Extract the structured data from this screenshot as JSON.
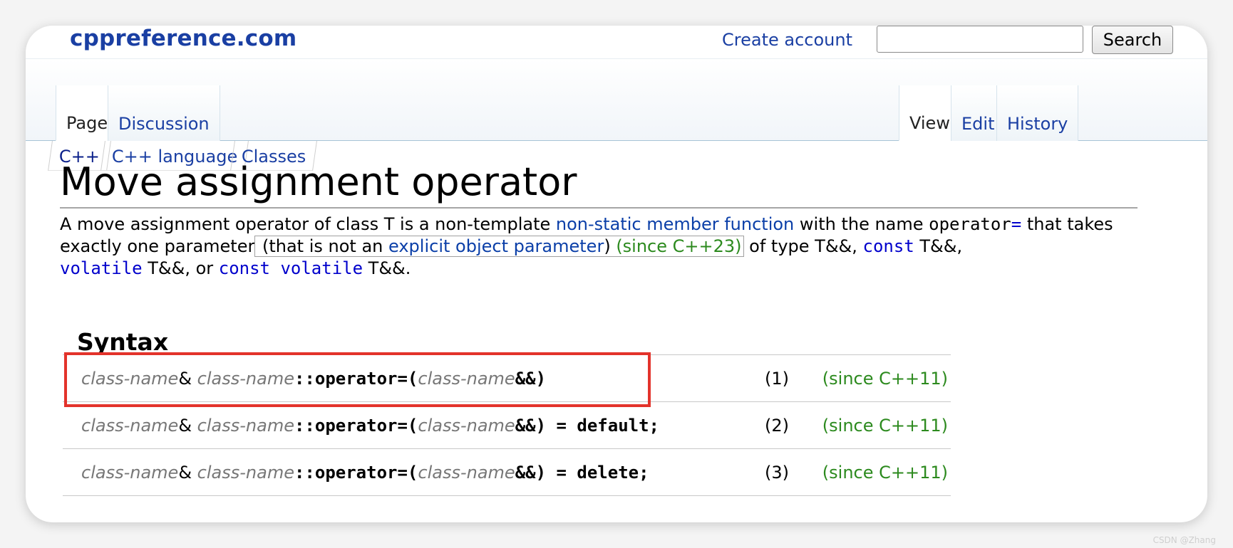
{
  "header": {
    "logo": "cppreference.com",
    "create_account": "Create account",
    "search_placeholder": "",
    "search_button": "Search"
  },
  "tabs_left": [
    {
      "label": "Page",
      "selected": true
    },
    {
      "label": "Discussion",
      "selected": false
    }
  ],
  "tabs_right": [
    {
      "label": "View",
      "selected": true
    },
    {
      "label": "Edit",
      "selected": false
    },
    {
      "label": "History",
      "selected": false
    }
  ],
  "breadcrumbs": [
    "C++",
    "C++ language",
    "Classes"
  ],
  "page": {
    "title": "Move assignment operator",
    "desc": {
      "t1": "A move assignment operator of class T is a non-template ",
      "link1": "non-static member function",
      "t2": " with the name ",
      "op_mono": "operator",
      "op_eq": "=",
      "t3": " that takes exactly one parameter",
      "box_t1": " (that is not an ",
      "box_link": "explicit object parameter",
      "box_t2": ") ",
      "box_since": "(since C++23)",
      "t4": " of type T&&, ",
      "kw_const": "const",
      "t5": " T&&, ",
      "kw_volatile": "volatile",
      "t6": " T&&, or ",
      "kw_const_volatile": "const volatile",
      "t7": " T&&."
    }
  },
  "syntax": {
    "heading": "Syntax",
    "param": "class-name",
    "amp": "&",
    "scope_op": "::operator=(",
    "rref_close": "&&)",
    "rows": [
      {
        "suffix": "",
        "num": "(1)",
        "since": "(since C++11)"
      },
      {
        "suffix": " = default;",
        "num": "(2)",
        "since": "(since C++11)"
      },
      {
        "suffix": " = delete;",
        "num": "(3)",
        "since": "(since C++11)"
      }
    ]
  },
  "watermark": "CSDN @Zhang"
}
